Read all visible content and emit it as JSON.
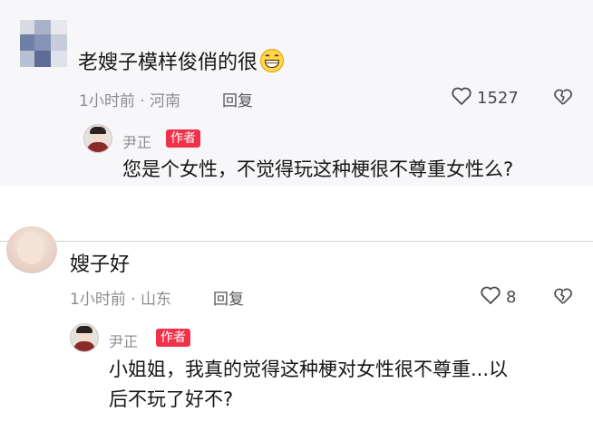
{
  "comments": [
    {
      "text": "老嫂子模样俊俏的很",
      "emoji_icon": "grinning-face-icon",
      "meta": "1小时前 · 河南",
      "reply_label": "回复",
      "likes": "1527",
      "reply": {
        "author": "尹正",
        "badge": "作者",
        "text": "您是个女性，不觉得玩这种梗很不尊重女性么?"
      }
    },
    {
      "text": "嫂子好",
      "meta": "1小时前 · 山东",
      "reply_label": "回复",
      "likes": "8",
      "reply": {
        "author": "尹正",
        "badge": "作者",
        "text_line1": "小姐姐，我真的觉得这种梗对女性很不尊重...以",
        "text_line2": "后不玩了好不?"
      }
    }
  ],
  "colors": {
    "badge": "#f0314a",
    "meta": "#8d8d91",
    "text": "#161616",
    "top_card_bg": "#f7f7f9"
  },
  "icons": [
    "heart-icon",
    "broken-heart-icon",
    "grinning-face-icon",
    "mosaic-avatar"
  ]
}
